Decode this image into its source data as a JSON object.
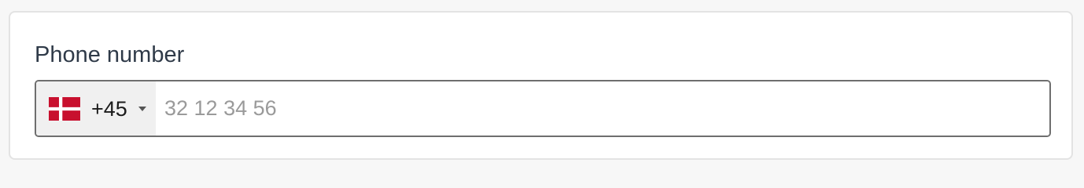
{
  "form": {
    "phone_label": "Phone number",
    "country": {
      "dial_code": "+45",
      "flag_icon": "denmark-flag-icon",
      "flag_colors": {
        "red": "#c8102e",
        "white": "#ffffff"
      }
    },
    "phone_input": {
      "value": "",
      "placeholder": "32 12 34 56"
    }
  },
  "colors": {
    "label_text": "#2f3a48",
    "input_border": "#6e6e6e",
    "country_bg": "#f0f0f0",
    "placeholder": "#9a9a9a"
  }
}
